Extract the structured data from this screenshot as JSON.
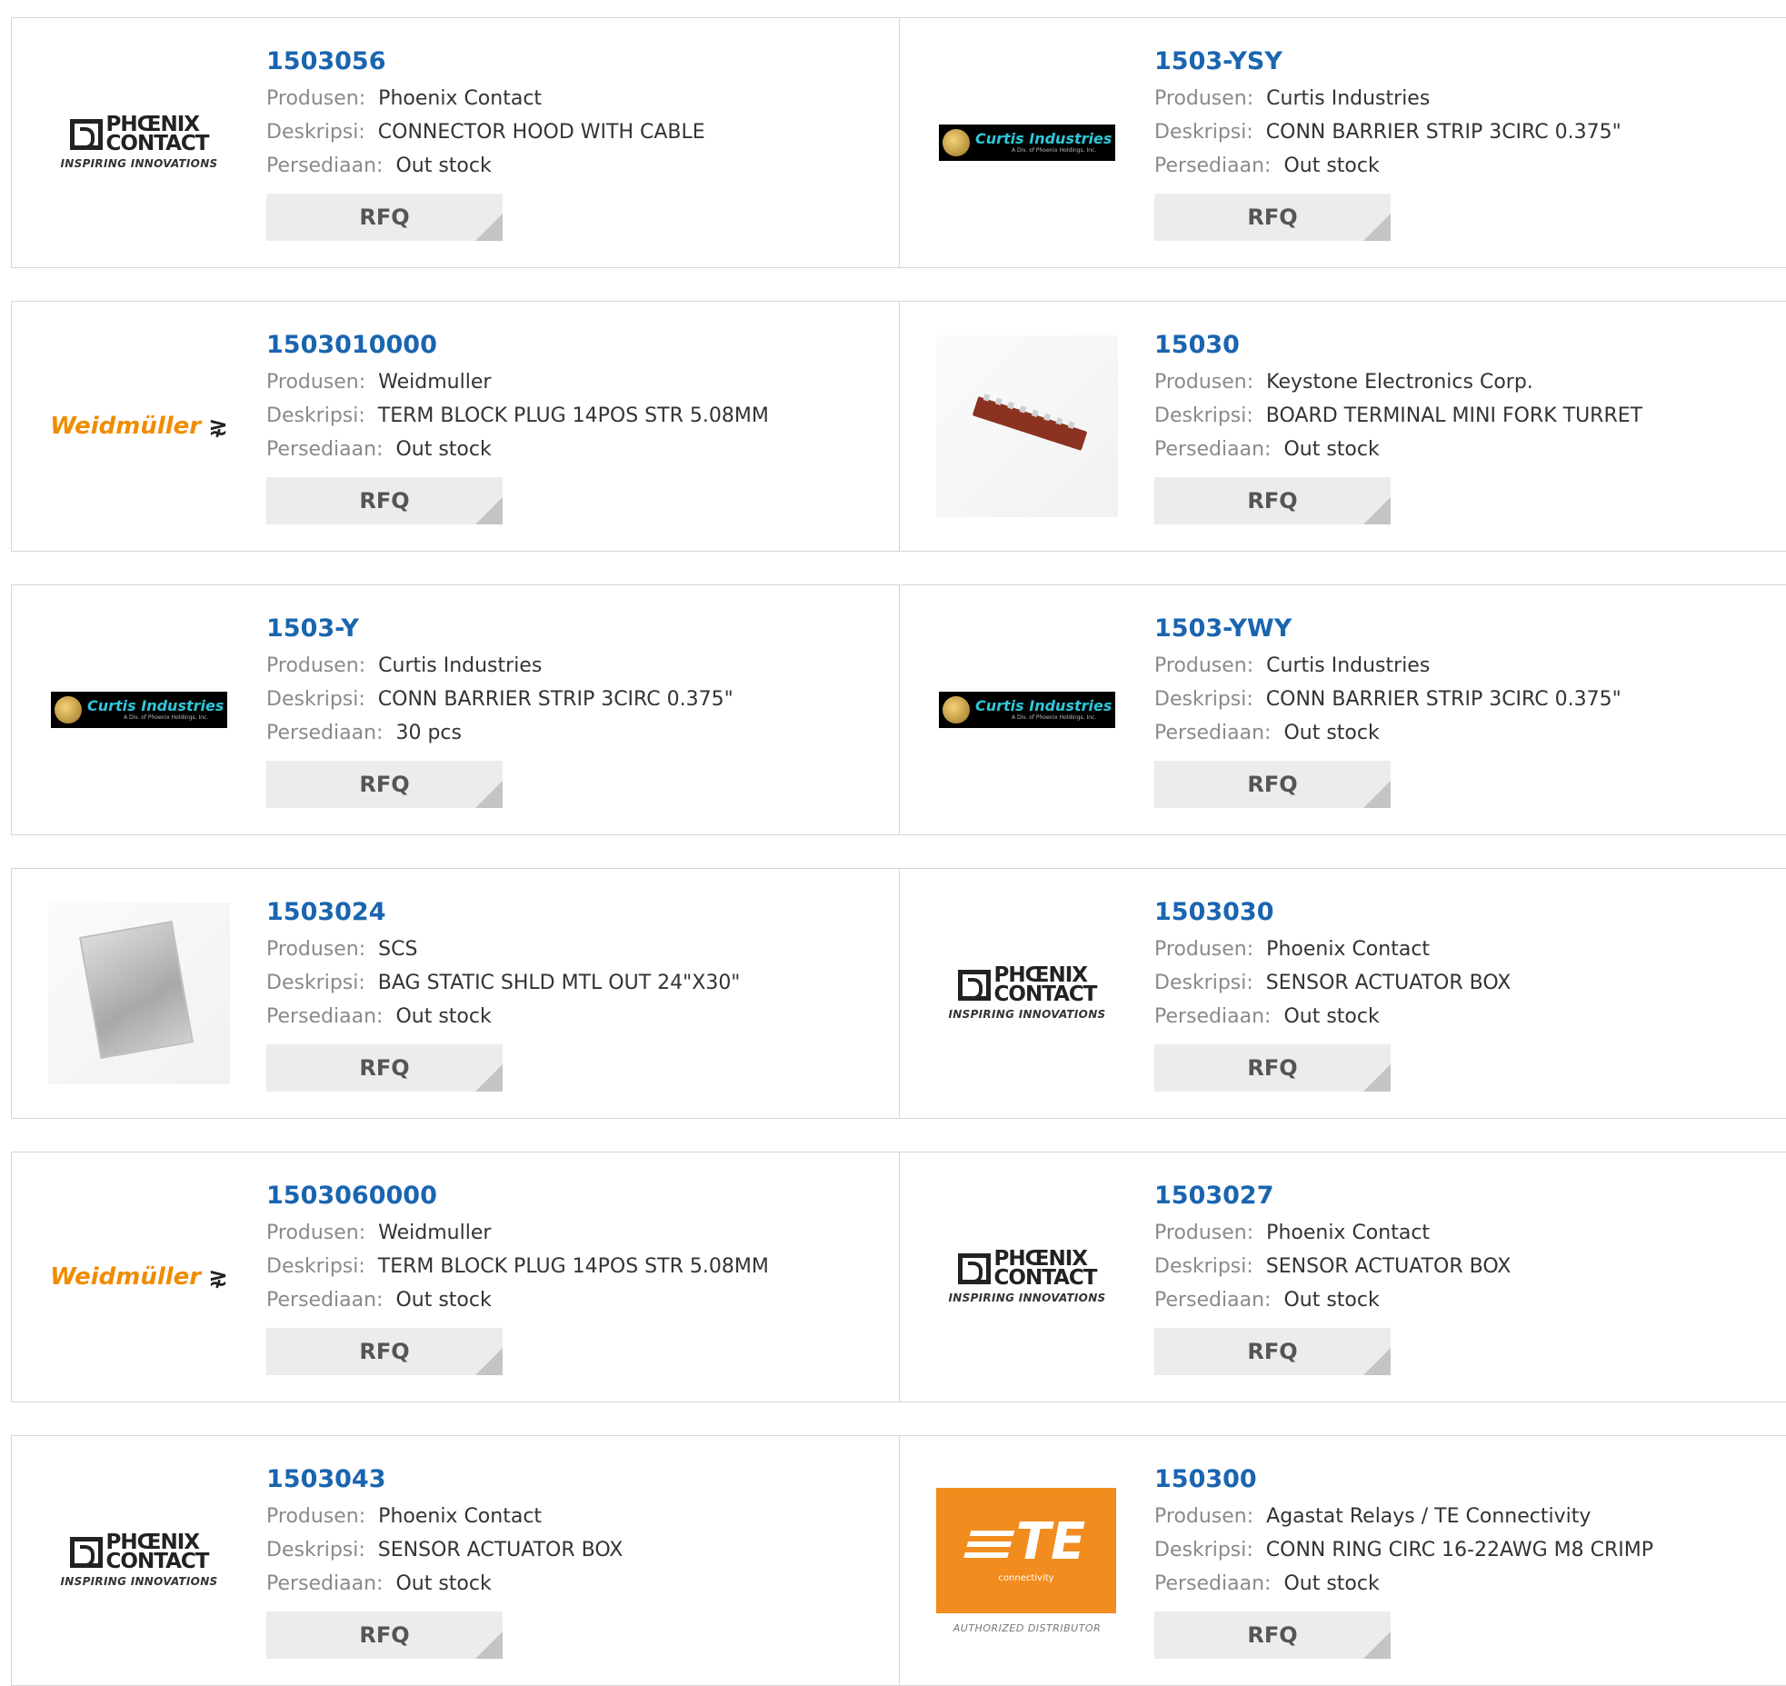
{
  "labels": {
    "manufacturer": "Produsen:",
    "description": "Deskripsi:",
    "stock": "Persediaan:",
    "rfq": "RFQ"
  },
  "logo_text": {
    "phoenix_line1": "PHŒNIX",
    "phoenix_line2": "CONTACT",
    "phoenix_tag": "INSPIRING INNOVATIONS",
    "curtis_name": "Curtis Industries",
    "curtis_sub": "A Div. of Phoenix Holdings, Inc.",
    "weidmuller": "Weidmüller",
    "te_main": "TE",
    "te_sub": "connectivity",
    "te_auth": "AUTHORIZED DISTRIBUTOR"
  },
  "products": [
    {
      "part": "1503056",
      "manufacturer": "Phoenix Contact",
      "description": "CONNECTOR HOOD WITH CABLE",
      "stock": "Out stock",
      "logo": "phoenix-logo"
    },
    {
      "part": "1503-YSY",
      "manufacturer": "Curtis Industries",
      "description": "CONN BARRIER STRIP 3CIRC 0.375\"",
      "stock": "Out stock",
      "logo": "curtis-logo"
    },
    {
      "part": "1503010000",
      "manufacturer": "Weidmuller",
      "description": "TERM BLOCK PLUG 14POS STR 5.08MM",
      "stock": "Out stock",
      "logo": "weidmuller-logo"
    },
    {
      "part": "15030",
      "manufacturer": "Keystone Electronics Corp.",
      "description": "BOARD TERMINAL MINI FORK TURRET",
      "stock": "Out stock",
      "logo": "terminal-board-photo"
    },
    {
      "part": "1503-Y",
      "manufacturer": "Curtis Industries",
      "description": "CONN BARRIER STRIP 3CIRC 0.375\"",
      "stock": "30 pcs",
      "logo": "curtis-logo"
    },
    {
      "part": "1503-YWY",
      "manufacturer": "Curtis Industries",
      "description": "CONN BARRIER STRIP 3CIRC 0.375\"",
      "stock": "Out stock",
      "logo": "curtis-logo"
    },
    {
      "part": "1503024",
      "manufacturer": "SCS",
      "description": "BAG STATIC SHLD MTL OUT 24\"X30\"",
      "stock": "Out stock",
      "logo": "static-bag-photo"
    },
    {
      "part": "1503030",
      "manufacturer": "Phoenix Contact",
      "description": "SENSOR ACTUATOR BOX",
      "stock": "Out stock",
      "logo": "phoenix-logo"
    },
    {
      "part": "1503060000",
      "manufacturer": "Weidmuller",
      "description": "TERM BLOCK PLUG 14POS STR 5.08MM",
      "stock": "Out stock",
      "logo": "weidmuller-logo"
    },
    {
      "part": "1503027",
      "manufacturer": "Phoenix Contact",
      "description": "SENSOR ACTUATOR BOX",
      "stock": "Out stock",
      "logo": "phoenix-logo"
    },
    {
      "part": "1503043",
      "manufacturer": "Phoenix Contact",
      "description": "SENSOR ACTUATOR BOX",
      "stock": "Out stock",
      "logo": "phoenix-logo"
    },
    {
      "part": "150300",
      "manufacturer": "Agastat Relays / TE Connectivity",
      "description": "CONN RING CIRC 16-22AWG M8 CRIMP",
      "stock": "Out stock",
      "logo": "te-logo"
    }
  ]
}
